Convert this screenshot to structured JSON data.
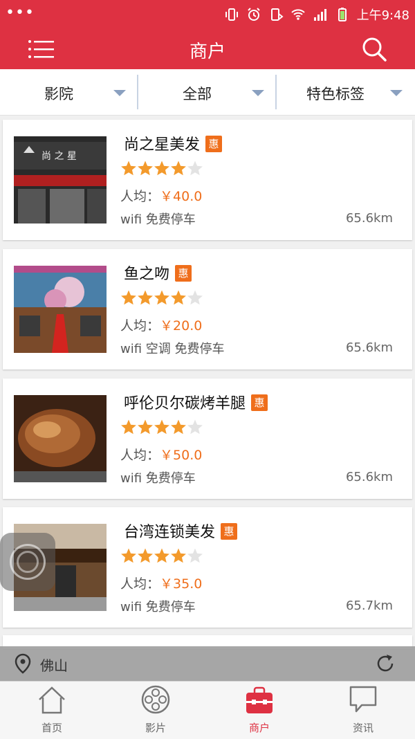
{
  "status_bar": {
    "time": "上午9:48"
  },
  "header": {
    "title": "商户"
  },
  "filters": [
    {
      "label": "影院"
    },
    {
      "label": "全部"
    },
    {
      "label": "特色标签"
    }
  ],
  "merchants": [
    {
      "name": "尚之星美发",
      "badge": "惠",
      "rating": 4,
      "price_prefix": "人均：",
      "price": "￥40.0",
      "tags": "wifi 免费停车",
      "distance": "65.6km",
      "thumb_sign": "尚 之 星"
    },
    {
      "name": "鱼之吻",
      "badge": "惠",
      "rating": 4,
      "price_prefix": "人均：",
      "price": "￥20.0",
      "tags": "wifi  空调 免费停车",
      "distance": "65.6km"
    },
    {
      "name": "呼伦贝尔碳烤羊腿",
      "badge": "惠",
      "rating": 4,
      "price_prefix": "人均：",
      "price": "￥50.0",
      "tags": "wifi 免费停车",
      "distance": "65.6km"
    },
    {
      "name": "台湾连锁美发",
      "badge": "惠",
      "rating": 4,
      "price_prefix": "人均：",
      "price": "￥35.0",
      "tags": "wifi 免费停车",
      "distance": "65.7km"
    }
  ],
  "location": {
    "city": "佛山"
  },
  "tabs": [
    {
      "label": "首页",
      "icon": "home-icon"
    },
    {
      "label": "影片",
      "icon": "film-reel-icon"
    },
    {
      "label": "商户",
      "icon": "shop-bag-icon",
      "active": true
    },
    {
      "label": "资讯",
      "icon": "chat-bubble-icon"
    }
  ],
  "colors": {
    "brand": "#de3142",
    "accent": "#ef6e1b",
    "star": "#f39a2c"
  }
}
